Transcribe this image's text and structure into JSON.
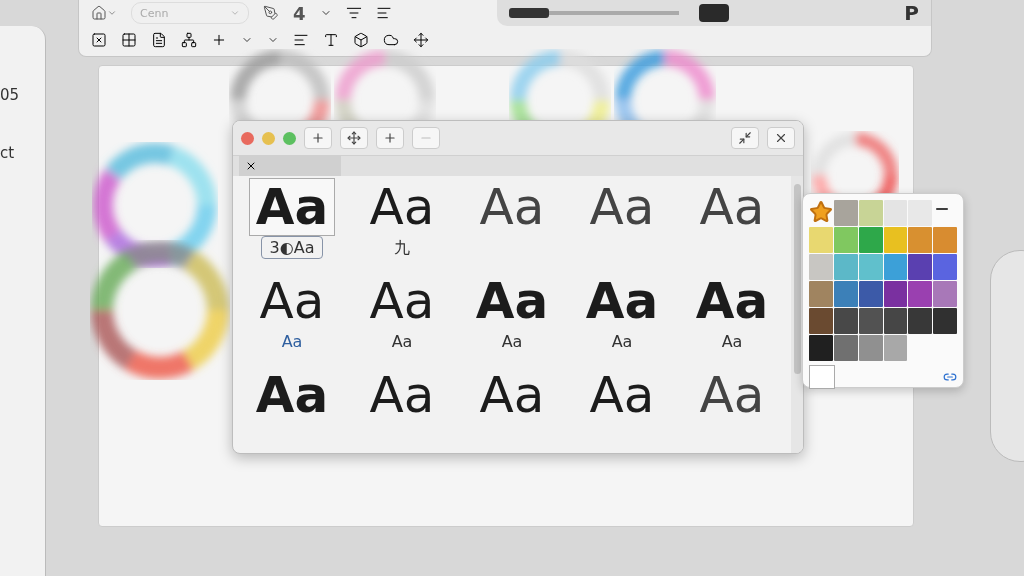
{
  "toolbar": {
    "font_field": {
      "placeholder": "Cenn"
    },
    "size": "4",
    "brand_letter": "P"
  },
  "side_panel": {
    "texts": [
      "05",
      "ct"
    ]
  },
  "font_window": {
    "rows": [
      [
        {
          "kind": "bold",
          "sample": "Aa",
          "label": "3◐Aa",
          "selected": true,
          "accent": false
        },
        {
          "kind": "regular",
          "sample": "Aa",
          "label": "九",
          "selected": false,
          "accent": false
        },
        {
          "kind": "light",
          "sample": "Aa",
          "selected": false
        },
        {
          "kind": "light",
          "sample": "Aa",
          "selected": false
        },
        {
          "kind": "light",
          "sample": "Aa",
          "selected": false
        }
      ],
      [
        {
          "kind": "regular",
          "sample": "Aa",
          "label": "Aa",
          "selected": false,
          "accent": true
        },
        {
          "kind": "regular",
          "sample": "Aa",
          "label": "Aa",
          "selected": false,
          "accent": false
        },
        {
          "kind": "bold",
          "sample": "Aa",
          "label": "Aa",
          "selected": false,
          "accent": false
        },
        {
          "kind": "bold",
          "sample": "Aa",
          "label": "Aa",
          "selected": false,
          "accent": false
        },
        {
          "kind": "bold",
          "sample": "Aa",
          "label": "Aa",
          "selected": false,
          "accent": false
        }
      ],
      [
        {
          "kind": "bold",
          "sample": "Aa",
          "selected": false
        },
        {
          "kind": "regular",
          "sample": "Aa",
          "selected": false
        },
        {
          "kind": "regular",
          "sample": "Aa",
          "selected": false
        },
        {
          "kind": "regular",
          "sample": "Aa",
          "selected": false
        },
        {
          "kind": "light",
          "sample": "Aa",
          "selected": false
        }
      ]
    ]
  },
  "palette": {
    "swatches": [
      {
        "kind": "favorite"
      },
      {
        "kind": "swatch",
        "color": "#a8a49c"
      },
      {
        "kind": "swatch",
        "color": "#c8d496"
      },
      {
        "kind": "swatch",
        "color": "#e4e4e4"
      },
      {
        "kind": "swatch",
        "color": "#e8e8e8"
      },
      {
        "kind": "menu"
      },
      {
        "kind": "swatch",
        "color": "#e8d870"
      },
      {
        "kind": "swatch",
        "color": "#80c860"
      },
      {
        "kind": "swatch",
        "color": "#2ea84a"
      },
      {
        "kind": "swatch",
        "color": "#e8c020"
      },
      {
        "kind": "swatch",
        "color": "#d89030"
      },
      {
        "kind": "swatch",
        "color": "#d88c30"
      },
      {
        "kind": "swatch",
        "color": "#c8c6c2"
      },
      {
        "kind": "swatch",
        "color": "#5cb8c8"
      },
      {
        "kind": "swatch",
        "color": "#60c0cc"
      },
      {
        "kind": "swatch",
        "color": "#3ca0d8"
      },
      {
        "kind": "swatch",
        "color": "#5a40b0"
      },
      {
        "kind": "swatch",
        "color": "#5a64e0"
      },
      {
        "kind": "swatch",
        "color": "#a08460"
      },
      {
        "kind": "swatch",
        "color": "#3c80b8"
      },
      {
        "kind": "swatch",
        "color": "#3c5aa8"
      },
      {
        "kind": "swatch",
        "color": "#7a30a0"
      },
      {
        "kind": "swatch",
        "color": "#9a40b0"
      },
      {
        "kind": "swatch",
        "color": "#a878b8"
      },
      {
        "kind": "swatch",
        "color": "#6a4a30"
      },
      {
        "kind": "swatch",
        "color": "#484848"
      },
      {
        "kind": "swatch",
        "color": "#525252"
      },
      {
        "kind": "swatch",
        "color": "#464646"
      },
      {
        "kind": "swatch",
        "color": "#383838"
      },
      {
        "kind": "swatch",
        "color": "#303030"
      },
      {
        "kind": "swatch",
        "color": "#202020"
      },
      {
        "kind": "swatch",
        "color": "#707070"
      },
      {
        "kind": "swatch",
        "color": "#909090"
      },
      {
        "kind": "swatch",
        "color": "#a8a8a8"
      }
    ]
  }
}
